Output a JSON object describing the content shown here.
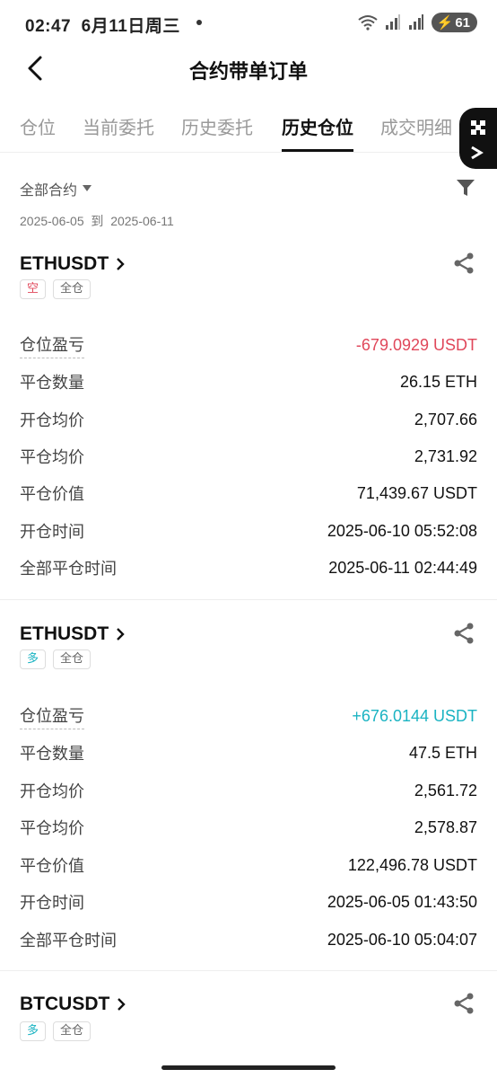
{
  "status": {
    "time": "02:47",
    "date": "6月11日周三",
    "battery": "61"
  },
  "nav": {
    "title": "合约带单订单"
  },
  "tabs": [
    "仓位",
    "当前委托",
    "历史委托",
    "历史仓位",
    "成交明细"
  ],
  "filter": {
    "contract": "全部合约",
    "from": "2025-06-05",
    "to_label": "到",
    "to": "2025-06-11"
  },
  "labels": {
    "pnl": "仓位盈亏",
    "close_qty": "平仓数量",
    "open_avg": "开仓均价",
    "close_avg": "平仓均价",
    "close_value": "平仓价值",
    "open_time": "开仓时间",
    "close_time": "全部平仓时间"
  },
  "positions": [
    {
      "symbol": "ETHUSDT",
      "side": "空",
      "mode": "全仓",
      "pnl": "-679.0929 USDT",
      "close_qty": "26.15 ETH",
      "open_avg": "2,707.66",
      "close_avg": "2,731.92",
      "close_value": "71,439.67 USDT",
      "open_time": "2025-06-10 05:52:08",
      "close_time": "2025-06-11 02:44:49"
    },
    {
      "symbol": "ETHUSDT",
      "side": "多",
      "mode": "全仓",
      "pnl": "+676.0144 USDT",
      "close_qty": "47.5 ETH",
      "open_avg": "2,561.72",
      "close_avg": "2,578.87",
      "close_value": "122,496.78 USDT",
      "open_time": "2025-06-05 01:43:50",
      "close_time": "2025-06-10 05:04:07"
    },
    {
      "symbol": "BTCUSDT",
      "side": "多",
      "mode": "全仓"
    }
  ],
  "colors": {
    "negative": "#e0475a",
    "positive": "#1ab3c2"
  }
}
